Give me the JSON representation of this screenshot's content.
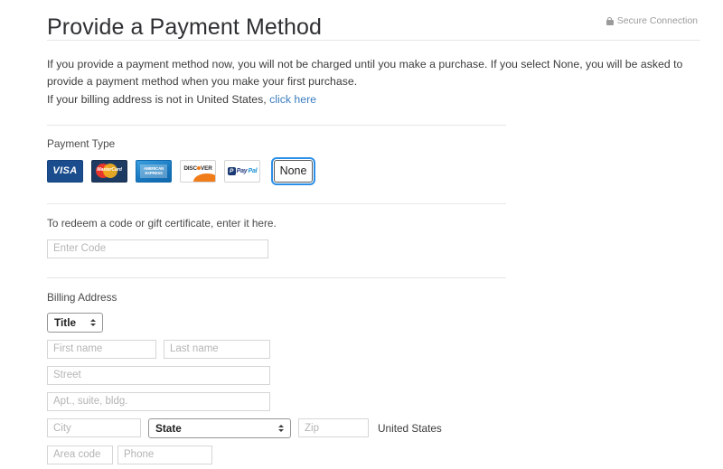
{
  "header": {
    "title": "Provide a Payment Method",
    "secure_label": "Secure Connection",
    "lock_icon": "lock-icon"
  },
  "intro": {
    "line1": "If you provide a payment method now, you will not be charged until you make a purchase. If you select None, you will be asked to provide a payment method when you make your first purchase.",
    "line2_prefix": "If your billing address is not in United States,",
    "line2_link": "click here"
  },
  "payment_type": {
    "label": "Payment Type",
    "options": [
      {
        "id": "visa",
        "name": "VISA",
        "icon": "visa-card-icon",
        "selected": false
      },
      {
        "id": "mastercard",
        "name": "MasterCard",
        "icon": "mastercard-card-icon",
        "selected": false
      },
      {
        "id": "amex",
        "name": "AMERICAN EXPRESS",
        "icon": "amex-card-icon",
        "selected": false
      },
      {
        "id": "discover",
        "name": "DISCOVER",
        "icon": "discover-card-icon",
        "selected": false
      },
      {
        "id": "paypal",
        "name": "PayPal",
        "icon": "paypal-card-icon",
        "selected": false
      },
      {
        "id": "none",
        "name": "None",
        "icon": "none-button",
        "selected": true
      }
    ],
    "visa_text": "VISA",
    "mastercard_text": "MasterCard",
    "amex_text": "AMERICAN EXPRESS",
    "discover_text_before": "DISC",
    "discover_text_after": "VER",
    "paypal_mark": "P",
    "paypal_text_1": "Pay",
    "paypal_text_2": "Pal",
    "none_text": "None"
  },
  "redeem": {
    "label": "To redeem a code or gift certificate, enter it here.",
    "input_placeholder": "Enter Code",
    "input_value": ""
  },
  "billing": {
    "label": "Billing Address",
    "title_select": "Title",
    "first_name_placeholder": "First name",
    "last_name_placeholder": "Last name",
    "street_placeholder": "Street",
    "apt_placeholder": "Apt., suite, bldg.",
    "city_placeholder": "City",
    "state_select": "State",
    "zip_placeholder": "Zip",
    "country_label": "United States",
    "area_code_placeholder": "Area code",
    "phone_placeholder": "Phone"
  },
  "colors": {
    "link": "#3b7dbf",
    "focus_ring": "#2c8fe8",
    "visa_bg": "#1a4c8e",
    "mastercard_bg": "#1d3a63",
    "discover_orange": "#f07d1a",
    "divider": "#e6e6e6"
  }
}
